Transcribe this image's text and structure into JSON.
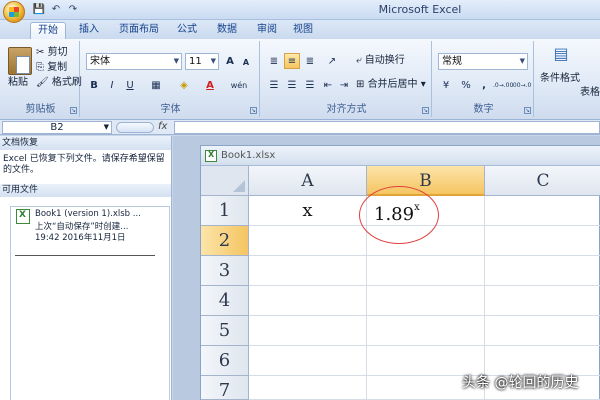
{
  "window": {
    "title": "Microsoft Excel"
  },
  "qat": {
    "save": "💾",
    "undo": "↶",
    "redo": "↷"
  },
  "tabs": [
    {
      "label": "开始",
      "active": true
    },
    {
      "label": "插入"
    },
    {
      "label": "页面布局"
    },
    {
      "label": "公式"
    },
    {
      "label": "数据"
    },
    {
      "label": "审阅"
    },
    {
      "label": "视图"
    }
  ],
  "ribbon": {
    "clipboard": {
      "label": "剪贴板",
      "paste": "粘贴",
      "cut": "剪切",
      "copy": "复制",
      "format_painter": "格式刷"
    },
    "font": {
      "label": "字体",
      "font_name": "宋体",
      "font_size": "11",
      "grow": "A",
      "shrink": "A",
      "bold": "B",
      "italic": "I",
      "underline": "U",
      "wen": "wén"
    },
    "alignment": {
      "label": "对齐方式",
      "wrap_text": "自动换行",
      "merge_center": "合并后居中"
    },
    "number": {
      "label": "数字",
      "format": "常规",
      "percent": "%",
      "comma": ",",
      "inc_decimal": ".0→.00",
      "dec_decimal": ".00→.0"
    },
    "styles": {
      "cond_format": "条件格式",
      "table_format": "表格"
    }
  },
  "formula_bar": {
    "name_box": "B2",
    "fx": "fx"
  },
  "recovery": {
    "header": "文档恢复",
    "message": "Excel 已恢复下列文件。请保存希望保留的文件。",
    "available": "可用文件",
    "item": {
      "name": "Book1 (version 1).xlsb ...",
      "line2": "上次“自动保存”时创建...",
      "line3": "19:42 2016年11月1日"
    }
  },
  "workbook": {
    "title": "Book1.xlsx",
    "columns": [
      "A",
      "B",
      "C"
    ],
    "rows": [
      "1",
      "2",
      "3",
      "4",
      "5",
      "6",
      "7"
    ],
    "cells": {
      "A1": "x",
      "B1_base": "1.89",
      "B1_exp": "x"
    }
  },
  "watermark": "头条 @轮回的历史"
}
